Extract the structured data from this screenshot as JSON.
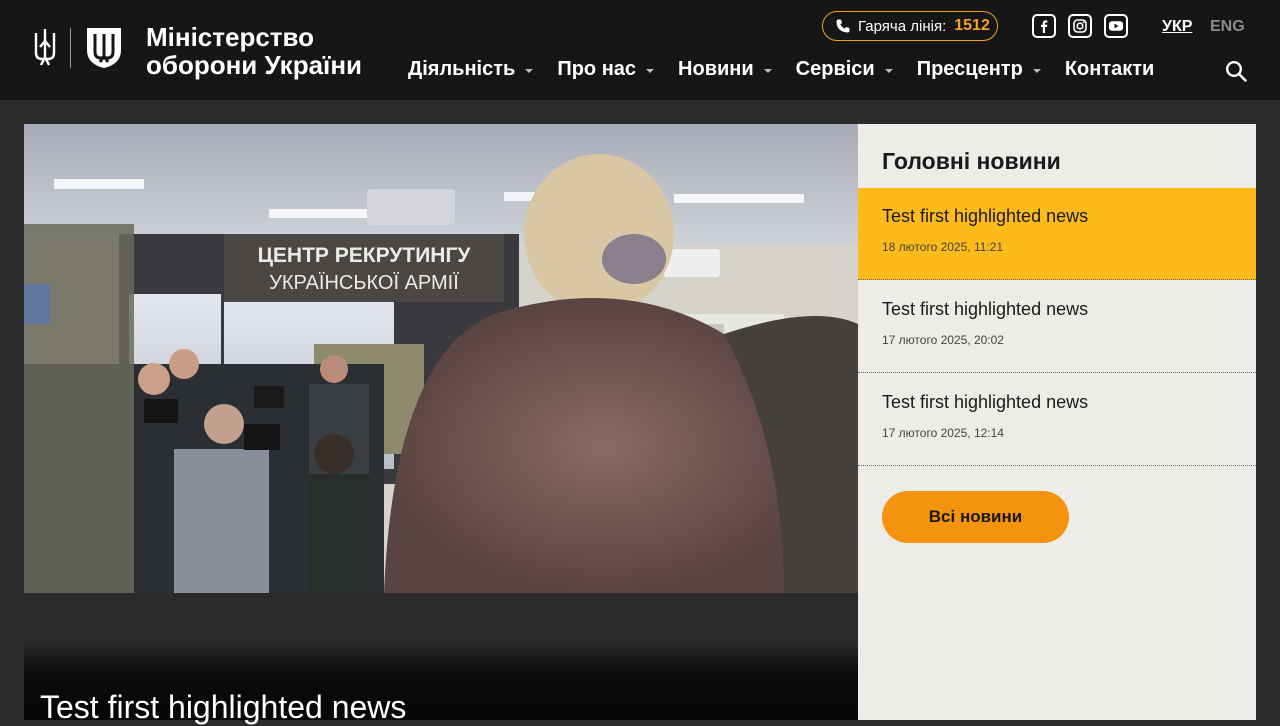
{
  "header": {
    "ministry_line1": "Міністерство",
    "ministry_line2": "оборони України",
    "hotline_label": "Гаряча лінія:",
    "hotline_number": "1512",
    "social_icons": [
      "facebook-icon",
      "instagram-icon",
      "youtube-icon"
    ],
    "lang_active": "УКР",
    "lang_other": "ENG",
    "nav": [
      "Діяльність",
      "Про нас",
      "Новини",
      "Сервіси",
      "Пресцентр",
      "Контакти"
    ]
  },
  "hero": {
    "banner_line1": "ЦЕНТР РЕКРУТИНГУ",
    "banner_line2": "УКРАЇНСЬКОЇ АРМІЇ",
    "title": "Test first highlighted news"
  },
  "sidebar": {
    "heading": "Головні новини",
    "news": [
      {
        "title": "Test first highlighted news",
        "date": "18 лютого 2025, 11:21",
        "active": true
      },
      {
        "title": "Test first highlighted news",
        "date": "17 лютого 2025, 20:02",
        "active": false
      },
      {
        "title": "Test first highlighted news",
        "date": "17 лютого 2025, 12:14",
        "active": false
      }
    ],
    "all_news_label": "Всі новини"
  },
  "colors": {
    "header_bg": "#161616",
    "accent_orange": "#f3930e",
    "highlight_yellow": "#fcbb1a",
    "sidebar_bg": "#eeece8"
  }
}
